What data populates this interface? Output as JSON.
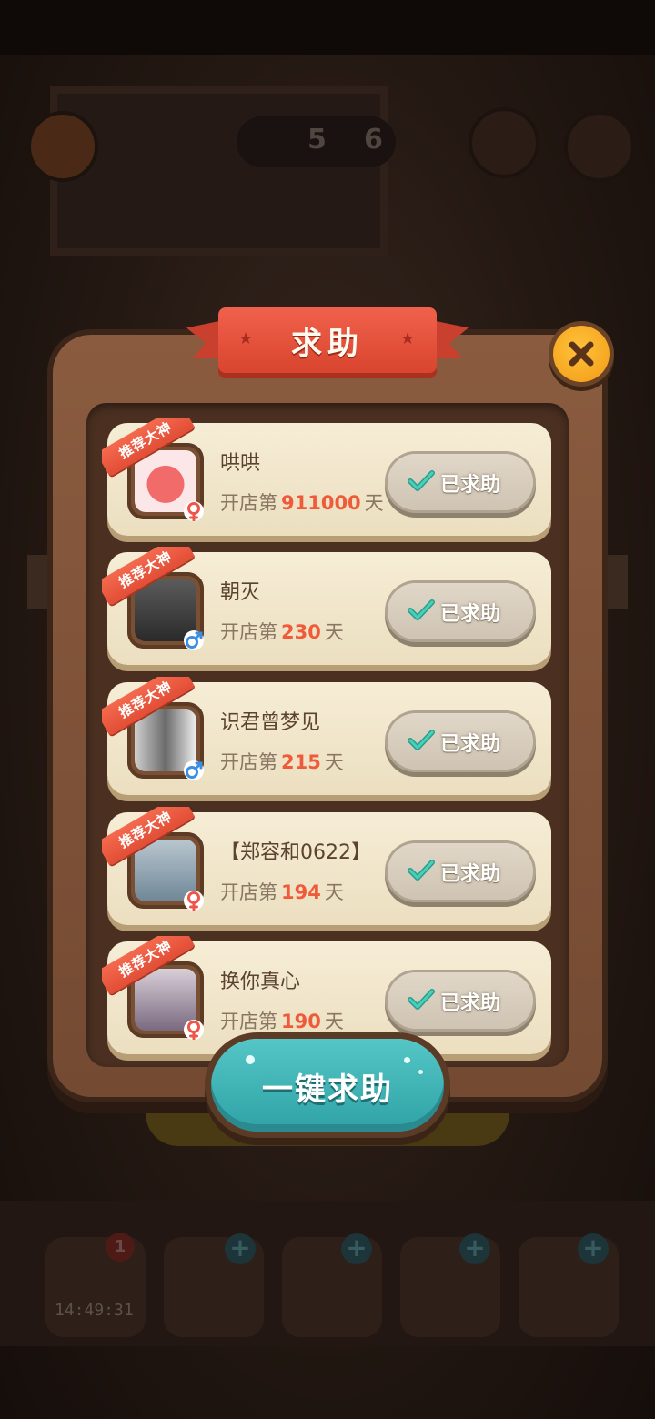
{
  "background": {
    "counter_left": "5",
    "counter_right": "6",
    "timer": "14:49:31",
    "badge_count": "1"
  },
  "modal": {
    "title": "求助",
    "close_icon": "close-icon",
    "accent_color": "#ef5b3a",
    "button_color": "#3bb2b5"
  },
  "rows": [
    {
      "badge": "推荐大神",
      "name": "哄哄",
      "days_prefix": "开店第",
      "days": "911000",
      "days_suffix": "天",
      "gender": "female",
      "button": "已求助"
    },
    {
      "badge": "推荐大神",
      "name": "朝灭",
      "days_prefix": "开店第",
      "days": "230",
      "days_suffix": "天",
      "gender": "male",
      "button": "已求助"
    },
    {
      "badge": "推荐大神",
      "name": "识君曾梦见",
      "days_prefix": "开店第",
      "days": "215",
      "days_suffix": "天",
      "gender": "male",
      "button": "已求助"
    },
    {
      "badge": "推荐大神",
      "name": "【郑容和0622】",
      "days_prefix": "开店第",
      "days": "194",
      "days_suffix": "天",
      "gender": "female",
      "button": "已求助"
    },
    {
      "badge": "推荐大神",
      "name": "换你真心",
      "days_prefix": "开店第",
      "days": "190",
      "days_suffix": "天",
      "gender": "female",
      "button": "已求助"
    }
  ],
  "action": {
    "help_all_label": "一键求助"
  }
}
